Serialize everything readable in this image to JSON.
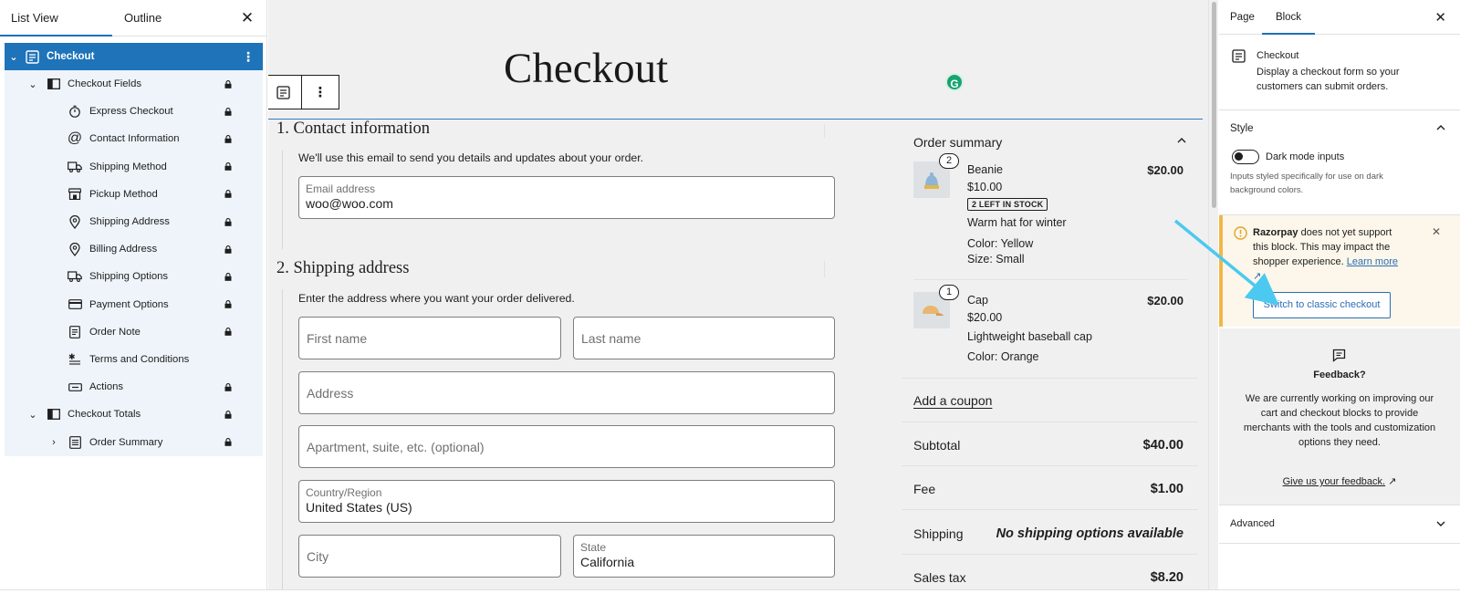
{
  "list_view": {
    "tab_list": "List View",
    "tab_outline": "Outline",
    "items": [
      {
        "label": "Checkout",
        "icon": "checkout-block-icon"
      },
      {
        "label": "Checkout Fields",
        "icon": "columns-icon"
      },
      {
        "label": "Express Checkout",
        "icon": "stopwatch-icon"
      },
      {
        "label": "Contact Information",
        "icon": "at-icon"
      },
      {
        "label": "Shipping Method",
        "icon": "truck-icon"
      },
      {
        "label": "Pickup Method",
        "icon": "store-icon"
      },
      {
        "label": "Shipping Address",
        "icon": "location-pin-icon"
      },
      {
        "label": "Billing Address",
        "icon": "location-pin-icon"
      },
      {
        "label": "Shipping Options",
        "icon": "truck-icon"
      },
      {
        "label": "Payment Options",
        "icon": "credit-card-icon"
      },
      {
        "label": "Order Note",
        "icon": "note-icon"
      },
      {
        "label": "Terms and Conditions",
        "icon": "terms-icon"
      },
      {
        "label": "Actions",
        "icon": "button-icon"
      },
      {
        "label": "Checkout Totals",
        "icon": "columns-icon"
      },
      {
        "label": "Order Summary",
        "icon": "summary-icon"
      }
    ]
  },
  "canvas": {
    "title": "Checkout",
    "grammarly": "G",
    "contact": {
      "title": "1.  Contact information",
      "description": "We'll use this email to send you details and updates about your order.",
      "email_label": "Email address",
      "email_value": "woo@woo.com"
    },
    "shipping": {
      "title": "2.  Shipping address",
      "description": "Enter the address where you want your order delivered.",
      "first_name": "First name",
      "last_name": "Last name",
      "address": "Address",
      "apartment": "Apartment, suite, etc. (optional)",
      "country_label": "Country/Region",
      "country_value": "United States (US)",
      "city": "City",
      "state_label": "State",
      "state_value": "California"
    },
    "order_summary": {
      "title": "Order summary",
      "items": [
        {
          "qty": "2",
          "name": "Beanie",
          "unit_price": "$10.00",
          "stock": "2 LEFT IN STOCK",
          "description": "Warm hat for winter",
          "attr1": "Color: Yellow",
          "attr2": "Size: Small",
          "total": "$20.00"
        },
        {
          "qty": "1",
          "name": "Cap",
          "unit_price": "$20.00",
          "description": "Lightweight baseball cap",
          "attr1": "Color: Orange",
          "total": "$20.00"
        }
      ],
      "coupon": "Add a coupon",
      "subtotal_label": "Subtotal",
      "subtotal_value": "$40.00",
      "fee_label": "Fee",
      "fee_value": "$1.00",
      "shipping_label": "Shipping",
      "shipping_value": "No shipping options available",
      "tax_label": "Sales tax",
      "tax_value": "$8.20"
    }
  },
  "settings": {
    "tab_page": "Page",
    "tab_block": "Block",
    "block_name": "Checkout",
    "block_description": "Display a checkout form so your customers can submit orders.",
    "style_title": "Style",
    "dark_mode_label": "Dark mode inputs",
    "dark_mode_help": "Inputs styled specifically for use on dark background colors.",
    "notice_brand": "Razorpay",
    "notice_text": " does not yet support this block. This may impact the shopper experience. ",
    "notice_link": "Learn more",
    "classic_button": "Switch to classic checkout",
    "feedback_title": "Feedback?",
    "feedback_text": "We are currently working on improving our cart and checkout blocks to provide merchants with the tools and customization options they need.",
    "feedback_link": "Give us your feedback.",
    "advanced_title": "Advanced"
  },
  "colors": {
    "accent": "#1e73b9",
    "notice_border": "#f0b849",
    "annotation_arrow": "#4cc9f0"
  }
}
